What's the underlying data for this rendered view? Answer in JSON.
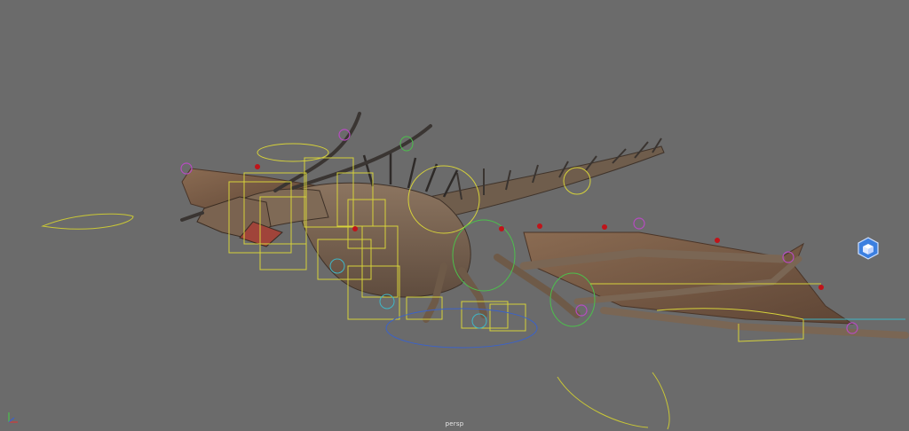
{
  "viewport": {
    "camera_label": "persp",
    "background_color": "#6b6b6b"
  },
  "scene": {
    "subject": "dragon-rig",
    "colors": {
      "wing_membrane": "#7a5c45",
      "body": "#86705a",
      "control_yellow": "#d6d23a",
      "control_magenta": "#b64cc0",
      "control_cyan": "#3fb6c6",
      "control_green": "#4cc04c",
      "locator_red": "#c0141a"
    }
  },
  "view_cube": {
    "icon": "view-cube-icon",
    "color": "#3b7fe0"
  },
  "axis_gizmo": {
    "icon": "axis-gizmo-icon"
  }
}
